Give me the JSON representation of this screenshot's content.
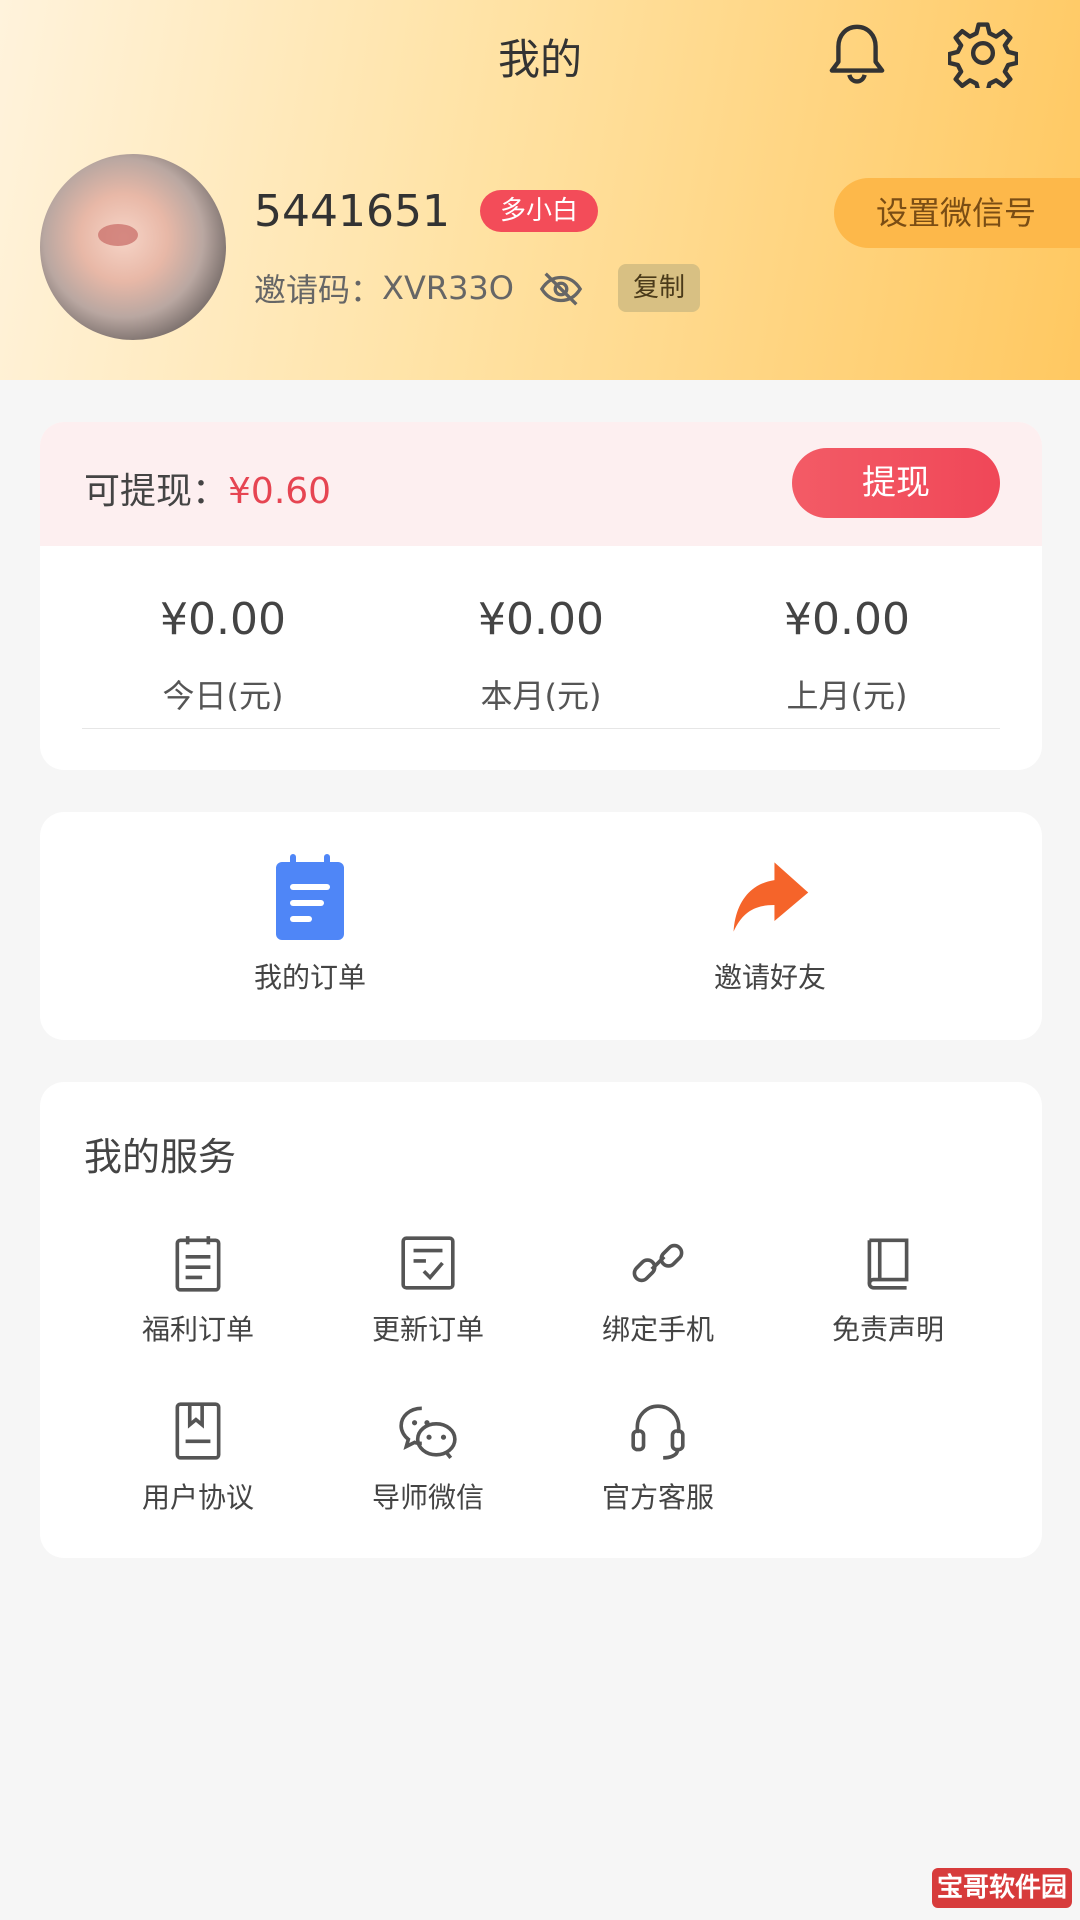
{
  "header": {
    "title": "我的",
    "user_id": "5441651",
    "level_badge": "多小白",
    "invite_label": "邀请码：",
    "invite_code": "XVR33O",
    "copy_label": "复制",
    "wechat_button": "设置微信号"
  },
  "balance": {
    "label": "可提现：",
    "value": "¥0.60",
    "withdraw_button": "提现",
    "stats": [
      {
        "value": "¥0.00",
        "label": "今日(元)"
      },
      {
        "value": "¥0.00",
        "label": "本月(元)"
      },
      {
        "value": "¥0.00",
        "label": "上月(元)"
      }
    ]
  },
  "quick": {
    "items": [
      {
        "label": "我的订单",
        "icon": "order-note-icon"
      },
      {
        "label": "邀请好友",
        "icon": "share-arrow-icon"
      }
    ]
  },
  "services": {
    "title": "我的服务",
    "items": [
      {
        "label": "福利订单",
        "icon": "clipboard-icon"
      },
      {
        "label": "更新订单",
        "icon": "checklist-icon"
      },
      {
        "label": "绑定手机",
        "icon": "link-icon"
      },
      {
        "label": "免责声明",
        "icon": "book-icon"
      },
      {
        "label": "用户协议",
        "icon": "agreement-icon"
      },
      {
        "label": "导师微信",
        "icon": "wechat-icon"
      },
      {
        "label": "官方客服",
        "icon": "headset-icon"
      }
    ]
  },
  "watermark": "宝哥软件园",
  "colors": {
    "accent": "#f04758",
    "header_gradient_end": "#ffc861",
    "primary_blue": "#4f86f7",
    "share_orange": "#f5642a"
  }
}
